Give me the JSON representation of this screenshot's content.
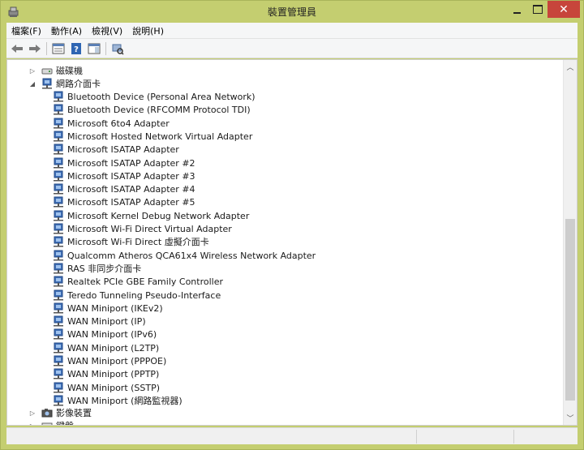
{
  "window": {
    "title": "裝置管理員",
    "close_glyph": "✕",
    "colors": {
      "frame": "#c4ce70",
      "close": "#c7453b"
    }
  },
  "menu": [
    {
      "label": "檔案(F)"
    },
    {
      "label": "動作(A)"
    },
    {
      "label": "檢視(V)"
    },
    {
      "label": "說明(H)"
    }
  ],
  "toolbar": {
    "icons": [
      "back-arrow-icon",
      "forward-arrow-icon",
      "properties-icon",
      "help-icon",
      "view-icon",
      "scan-hardware-icon"
    ]
  },
  "tree": {
    "disk_drives": "磁碟機",
    "network_adapters": "網路介面卡",
    "adapters": [
      "Bluetooth Device (Personal Area Network)",
      "Bluetooth Device (RFCOMM Protocol TDI)",
      "Microsoft 6to4 Adapter",
      "Microsoft Hosted Network Virtual Adapter",
      "Microsoft ISATAP Adapter",
      "Microsoft ISATAP Adapter #2",
      "Microsoft ISATAP Adapter #3",
      "Microsoft ISATAP Adapter #4",
      "Microsoft ISATAP Adapter #5",
      "Microsoft Kernel Debug Network Adapter",
      "Microsoft Wi-Fi Direct Virtual Adapter",
      "Microsoft Wi-Fi Direct 虛擬介面卡",
      "Qualcomm Atheros QCA61x4 Wireless Network Adapter",
      "RAS 非同步介面卡",
      "Realtek PCIe GBE Family Controller",
      "Teredo Tunneling Pseudo-Interface",
      "WAN Miniport (IKEv2)",
      "WAN Miniport (IP)",
      "WAN Miniport (IPv6)",
      "WAN Miniport (L2TP)",
      "WAN Miniport (PPPOE)",
      "WAN Miniport (PPTP)",
      "WAN Miniport (SSTP)",
      "WAN Miniport (網路監視器)"
    ],
    "imaging_devices": "影像裝置",
    "keyboards": "鍵盤"
  }
}
